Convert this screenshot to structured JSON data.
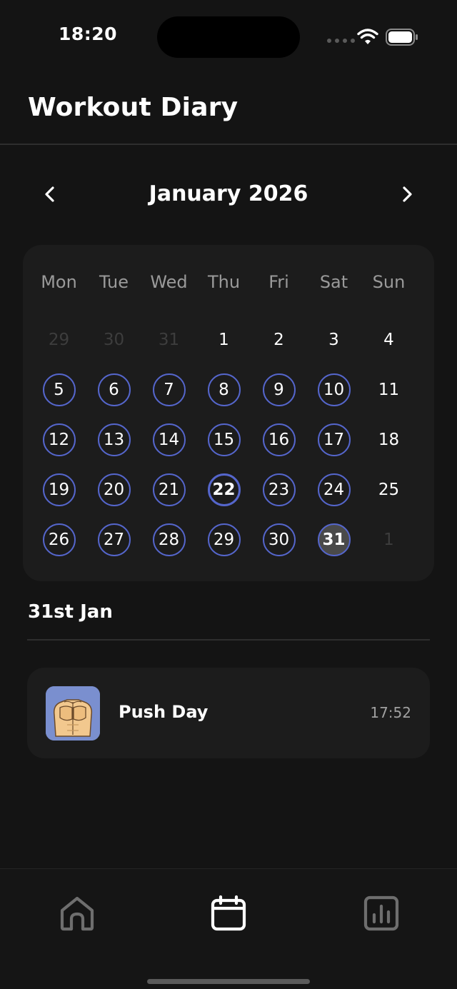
{
  "status_bar": {
    "time": "18:20"
  },
  "header": {
    "title": "Workout Diary"
  },
  "calendar": {
    "month_label": "January 2026",
    "weekdays": [
      "Mon",
      "Tue",
      "Wed",
      "Thu",
      "Fri",
      "Sat",
      "Sun"
    ],
    "days": [
      {
        "label": "29",
        "state": "outside"
      },
      {
        "label": "30",
        "state": "outside"
      },
      {
        "label": "31",
        "state": "outside"
      },
      {
        "label": "1",
        "state": "plain"
      },
      {
        "label": "2",
        "state": "plain"
      },
      {
        "label": "3",
        "state": "plain"
      },
      {
        "label": "4",
        "state": "plain"
      },
      {
        "label": "5",
        "state": "workout"
      },
      {
        "label": "6",
        "state": "workout"
      },
      {
        "label": "7",
        "state": "workout"
      },
      {
        "label": "8",
        "state": "workout"
      },
      {
        "label": "9",
        "state": "workout"
      },
      {
        "label": "10",
        "state": "workout"
      },
      {
        "label": "11",
        "state": "plain"
      },
      {
        "label": "12",
        "state": "workout"
      },
      {
        "label": "13",
        "state": "workout"
      },
      {
        "label": "14",
        "state": "workout"
      },
      {
        "label": "15",
        "state": "workout"
      },
      {
        "label": "16",
        "state": "workout"
      },
      {
        "label": "17",
        "state": "workout"
      },
      {
        "label": "18",
        "state": "plain"
      },
      {
        "label": "19",
        "state": "workout"
      },
      {
        "label": "20",
        "state": "workout"
      },
      {
        "label": "21",
        "state": "workout"
      },
      {
        "label": "22",
        "state": "workout-bold"
      },
      {
        "label": "23",
        "state": "workout"
      },
      {
        "label": "24",
        "state": "workout"
      },
      {
        "label": "25",
        "state": "plain"
      },
      {
        "label": "26",
        "state": "workout"
      },
      {
        "label": "27",
        "state": "workout"
      },
      {
        "label": "28",
        "state": "workout"
      },
      {
        "label": "29",
        "state": "workout"
      },
      {
        "label": "30",
        "state": "workout"
      },
      {
        "label": "31",
        "state": "selected"
      },
      {
        "label": "1",
        "state": "outside"
      }
    ],
    "colors": {
      "workout_ring": "#5566cc",
      "selected_fill": "#4a4a4a",
      "outside_text": "#3d3d3d"
    }
  },
  "selected_day": {
    "label": "31st Jan"
  },
  "workouts": [
    {
      "name": "Push Day",
      "time": "17:52",
      "icon": "chest-muscle-icon"
    }
  ],
  "tab_bar": {
    "items": [
      {
        "icon": "home-icon",
        "active": false
      },
      {
        "icon": "calendar-icon",
        "active": true
      },
      {
        "icon": "bar-chart-icon",
        "active": false
      }
    ]
  }
}
